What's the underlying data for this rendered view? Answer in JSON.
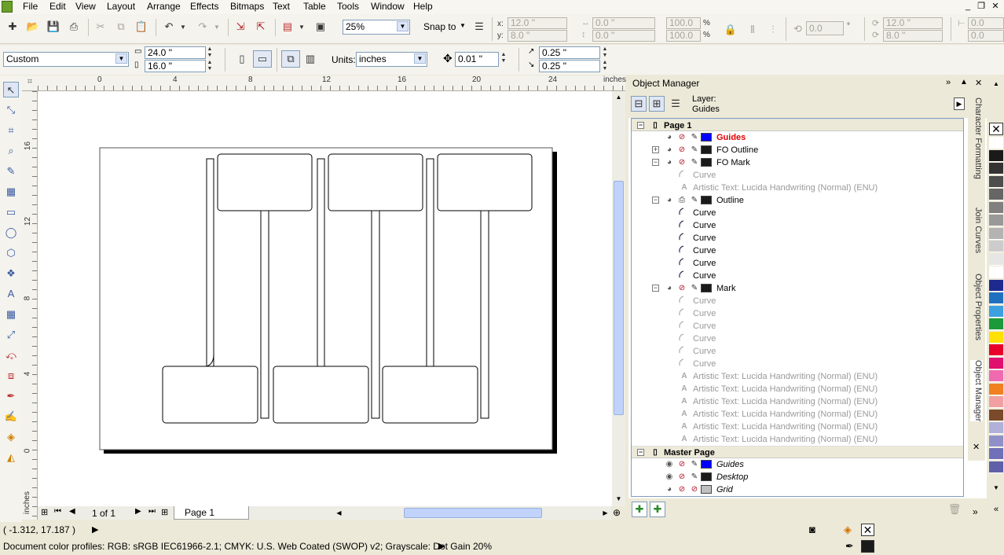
{
  "menu": [
    "File",
    "Edit",
    "View",
    "Layout",
    "Arrange",
    "Effects",
    "Bitmaps",
    "Text",
    "Table",
    "Tools",
    "Window",
    "Help"
  ],
  "toolbar": {
    "zoom": "25%",
    "snap_to": "Snap to",
    "x_label": "x:",
    "y_label": "y:",
    "x_value": "12.0 \"",
    "y_value": "8.0 \"",
    "w_value": "0.0 \"",
    "h_value": "0.0 \"",
    "scale_w": "100.0",
    "scale_h": "100.0",
    "pct": "%",
    "angle": "0.0",
    "deg": "°",
    "pos_x2": "12.0 \"",
    "pos_y2": "8.0 \"",
    "outline_a": "0.0",
    "outline_b": "0.0"
  },
  "propbar": {
    "page_size": "Custom",
    "width": "24.0 \"",
    "height": "16.0 \"",
    "units_label": "Units:",
    "units": "inches",
    "nudge": "0.01 \"",
    "dup_x": "0.25 \"",
    "dup_y": "0.25 \""
  },
  "ruler": {
    "h_ticks": [
      "0",
      "4",
      "8",
      "12",
      "16",
      "20",
      "24"
    ],
    "h_unit": "inches",
    "v_ticks": [
      "16",
      "12",
      "8",
      "4",
      "0"
    ],
    "v_unit": "inches"
  },
  "page_nav": {
    "counter": "1 of 1",
    "tab": "Page 1"
  },
  "object_manager": {
    "title": "Object Manager",
    "layer_label": "Layer:",
    "layer_name": "Guides",
    "rows": [
      {
        "kind": "page",
        "label": "Page 1"
      },
      {
        "kind": "layer",
        "label": "Guides",
        "color": "#0000ff",
        "expand": "",
        "bold_red": true
      },
      {
        "kind": "layer",
        "label": "FO Outline",
        "color": "#1a1a1a",
        "expand": "+"
      },
      {
        "kind": "layer",
        "label": "FO Mark",
        "color": "#1a1a1a",
        "expand": "-"
      },
      {
        "kind": "curve",
        "label": "Curve",
        "dim": true
      },
      {
        "kind": "text",
        "label": "Artistic Text: Lucida Handwriting (Normal) (ENU)",
        "dim": true
      },
      {
        "kind": "layer",
        "label": "Outline",
        "color": "#1a1a1a",
        "expand": "-",
        "printer": true
      },
      {
        "kind": "curve",
        "label": "Curve"
      },
      {
        "kind": "curve",
        "label": "Curve"
      },
      {
        "kind": "curve",
        "label": "Curve"
      },
      {
        "kind": "curve",
        "label": "Curve"
      },
      {
        "kind": "curve",
        "label": "Curve"
      },
      {
        "kind": "curve",
        "label": "Curve"
      },
      {
        "kind": "layer",
        "label": "Mark",
        "color": "#1a1a1a",
        "expand": "-"
      },
      {
        "kind": "curve",
        "label": "Curve",
        "dim": true
      },
      {
        "kind": "curve",
        "label": "Curve",
        "dim": true
      },
      {
        "kind": "curve",
        "label": "Curve",
        "dim": true
      },
      {
        "kind": "curve",
        "label": "Curve",
        "dim": true
      },
      {
        "kind": "curve",
        "label": "Curve",
        "dim": true
      },
      {
        "kind": "curve",
        "label": "Curve",
        "dim": true
      },
      {
        "kind": "text",
        "label": "Artistic Text: Lucida Handwriting (Normal) (ENU)",
        "dim": true
      },
      {
        "kind": "text",
        "label": "Artistic Text: Lucida Handwriting (Normal) (ENU)",
        "dim": true
      },
      {
        "kind": "text",
        "label": "Artistic Text: Lucida Handwriting (Normal) (ENU)",
        "dim": true
      },
      {
        "kind": "text",
        "label": "Artistic Text: Lucida Handwriting (Normal) (ENU)",
        "dim": true
      },
      {
        "kind": "text",
        "label": "Artistic Text: Lucida Handwriting (Normal) (ENU)",
        "dim": true
      },
      {
        "kind": "text",
        "label": "Artistic Text: Lucida Handwriting (Normal) (ENU)",
        "dim": true
      },
      {
        "kind": "page",
        "label": "Master Page"
      },
      {
        "kind": "mlayer",
        "label": "Guides",
        "color": "#0000ff"
      },
      {
        "kind": "mlayer",
        "label": "Desktop",
        "color": "#1a1a1a"
      },
      {
        "kind": "mlayer",
        "label": "Grid",
        "color": "#c0c0c0"
      }
    ]
  },
  "side_tabs": [
    "Character Formatting",
    "Join Curves",
    "Object Properties",
    "Object Manager"
  ],
  "palette": [
    "#ffffff",
    "#1a1a1a",
    "#333333",
    "#4d4d4d",
    "#666666",
    "#808080",
    "#999999",
    "#b3b3b3",
    "#cccccc",
    "#e6e6e6",
    "#ffffff",
    "#1f2a8f",
    "#2070c0",
    "#3ba0e0",
    "#1a9a3a",
    "#ffe000",
    "#e8002a",
    "#e01070",
    "#f06ab0",
    "#f08020",
    "#f0a0a0",
    "#7a4a2a",
    "#b0b0d8",
    "#9090c8",
    "#7070b8",
    "#6060a8"
  ],
  "status": {
    "coords": "( -1.312, 17.187 )",
    "profiles": "Document color profiles: RGB: sRGB IEC61966-2.1; CMYK: U.S. Web Coated (SWOP) v2; Grayscale: Dot Gain 20%"
  }
}
